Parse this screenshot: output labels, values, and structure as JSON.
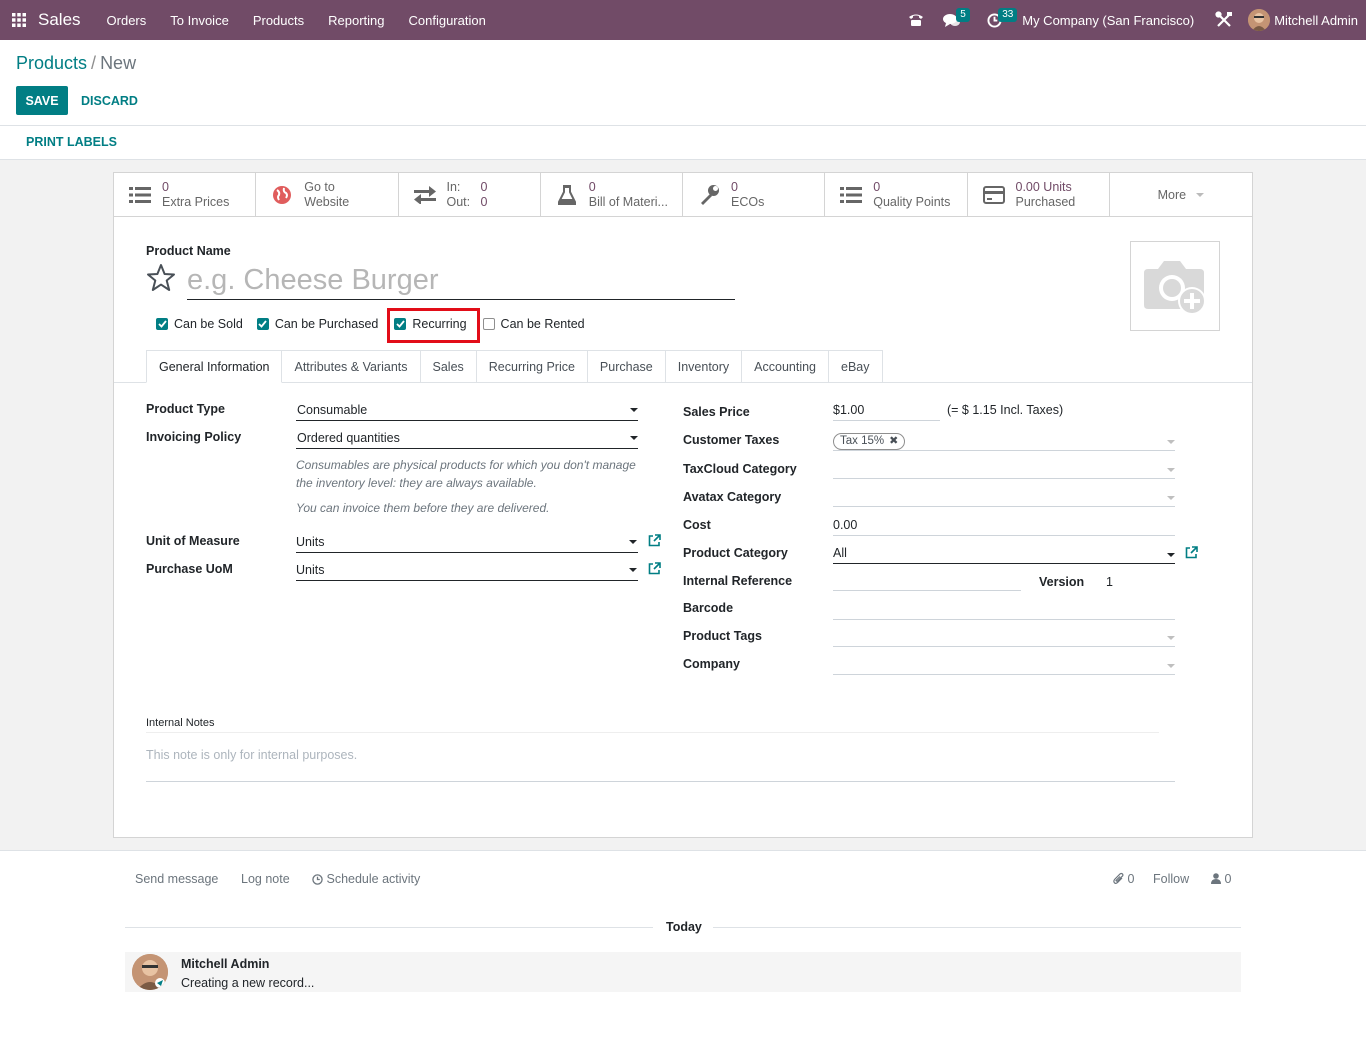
{
  "navbar": {
    "brand": "Sales",
    "menus": [
      "Orders",
      "To Invoice",
      "Products",
      "Reporting",
      "Configuration"
    ],
    "messages_count": "5",
    "activities_count": "33",
    "company": "My Company (San Francisco)",
    "user": "Mitchell Admin"
  },
  "breadcrumb": {
    "parent": "Products",
    "separator": "/",
    "current": "New"
  },
  "buttons": {
    "save": "SAVE",
    "discard": "DISCARD",
    "print_labels": "PRINT LABELS"
  },
  "smart_buttons": {
    "extra_prices": {
      "value": "0",
      "label": "Extra Prices",
      "icon": "list-icon"
    },
    "website": {
      "line1": "Go to",
      "line2": "Website",
      "icon": "globe-icon"
    },
    "inout": {
      "in_label": "In:",
      "in_value": "0",
      "out_label": "Out:",
      "out_value": "0",
      "icon": "exchange-icon"
    },
    "bom": {
      "value": "0",
      "label": "Bill of Materi...",
      "icon": "flask-icon"
    },
    "ecos": {
      "value": "0",
      "label": "ECOs",
      "icon": "wrench-icon"
    },
    "quality": {
      "value": "0",
      "label": "Quality Points",
      "icon": "list-icon"
    },
    "purchased": {
      "value": "0.00 Units",
      "label": "Purchased",
      "icon": "credit-card-icon"
    },
    "more": "More"
  },
  "form": {
    "product_name_label": "Product Name",
    "product_name_placeholder": "e.g. Cheese Burger",
    "checkboxes": {
      "can_be_sold": {
        "label": "Can be Sold",
        "checked": true
      },
      "can_be_purchased": {
        "label": "Can be Purchased",
        "checked": true
      },
      "recurring": {
        "label": "Recurring",
        "checked": true
      },
      "can_be_rented": {
        "label": "Can be Rented",
        "checked": false
      }
    },
    "tabs": [
      "General Information",
      "Attributes & Variants",
      "Sales",
      "Recurring Price",
      "Purchase",
      "Inventory",
      "Accounting",
      "eBay"
    ],
    "left": {
      "product_type_label": "Product Type",
      "product_type_value": "Consumable",
      "invoicing_policy_label": "Invoicing Policy",
      "invoicing_policy_value": "Ordered quantities",
      "help1": "Consumables are physical products for which you don't manage the inventory level: they are always available.",
      "help2": "You can invoice them before they are delivered.",
      "uom_label": "Unit of Measure",
      "uom_value": "Units",
      "purchase_uom_label": "Purchase UoM",
      "purchase_uom_value": "Units"
    },
    "right": {
      "sales_price_label": "Sales Price",
      "sales_price_value": "$1.00",
      "sales_price_incl": "(= $ 1.15 Incl. Taxes)",
      "customer_taxes_label": "Customer Taxes",
      "customer_taxes_tag": "Tax 15%",
      "taxcloud_label": "TaxCloud Category",
      "avatax_label": "Avatax Category",
      "cost_label": "Cost",
      "cost_value": "0.00",
      "category_label": "Product Category",
      "category_value": "All",
      "internal_ref_label": "Internal Reference",
      "version_label": "Version",
      "version_value": "1",
      "barcode_label": "Barcode",
      "tags_label": "Product Tags",
      "company_label": "Company"
    },
    "notes_label": "Internal Notes",
    "notes_placeholder": "This note is only for internal purposes."
  },
  "chatter": {
    "send_message": "Send message",
    "log_note": "Log note",
    "schedule_activity": "Schedule activity",
    "attachments_count": "0",
    "follow": "Follow",
    "followers_count": "0",
    "date_separator": "Today",
    "message_author": "Mitchell Admin",
    "message_body": "Creating a new record..."
  },
  "colors": {
    "navbar": "#714b67",
    "primary": "#017e84",
    "highlight": "#e20d18"
  }
}
